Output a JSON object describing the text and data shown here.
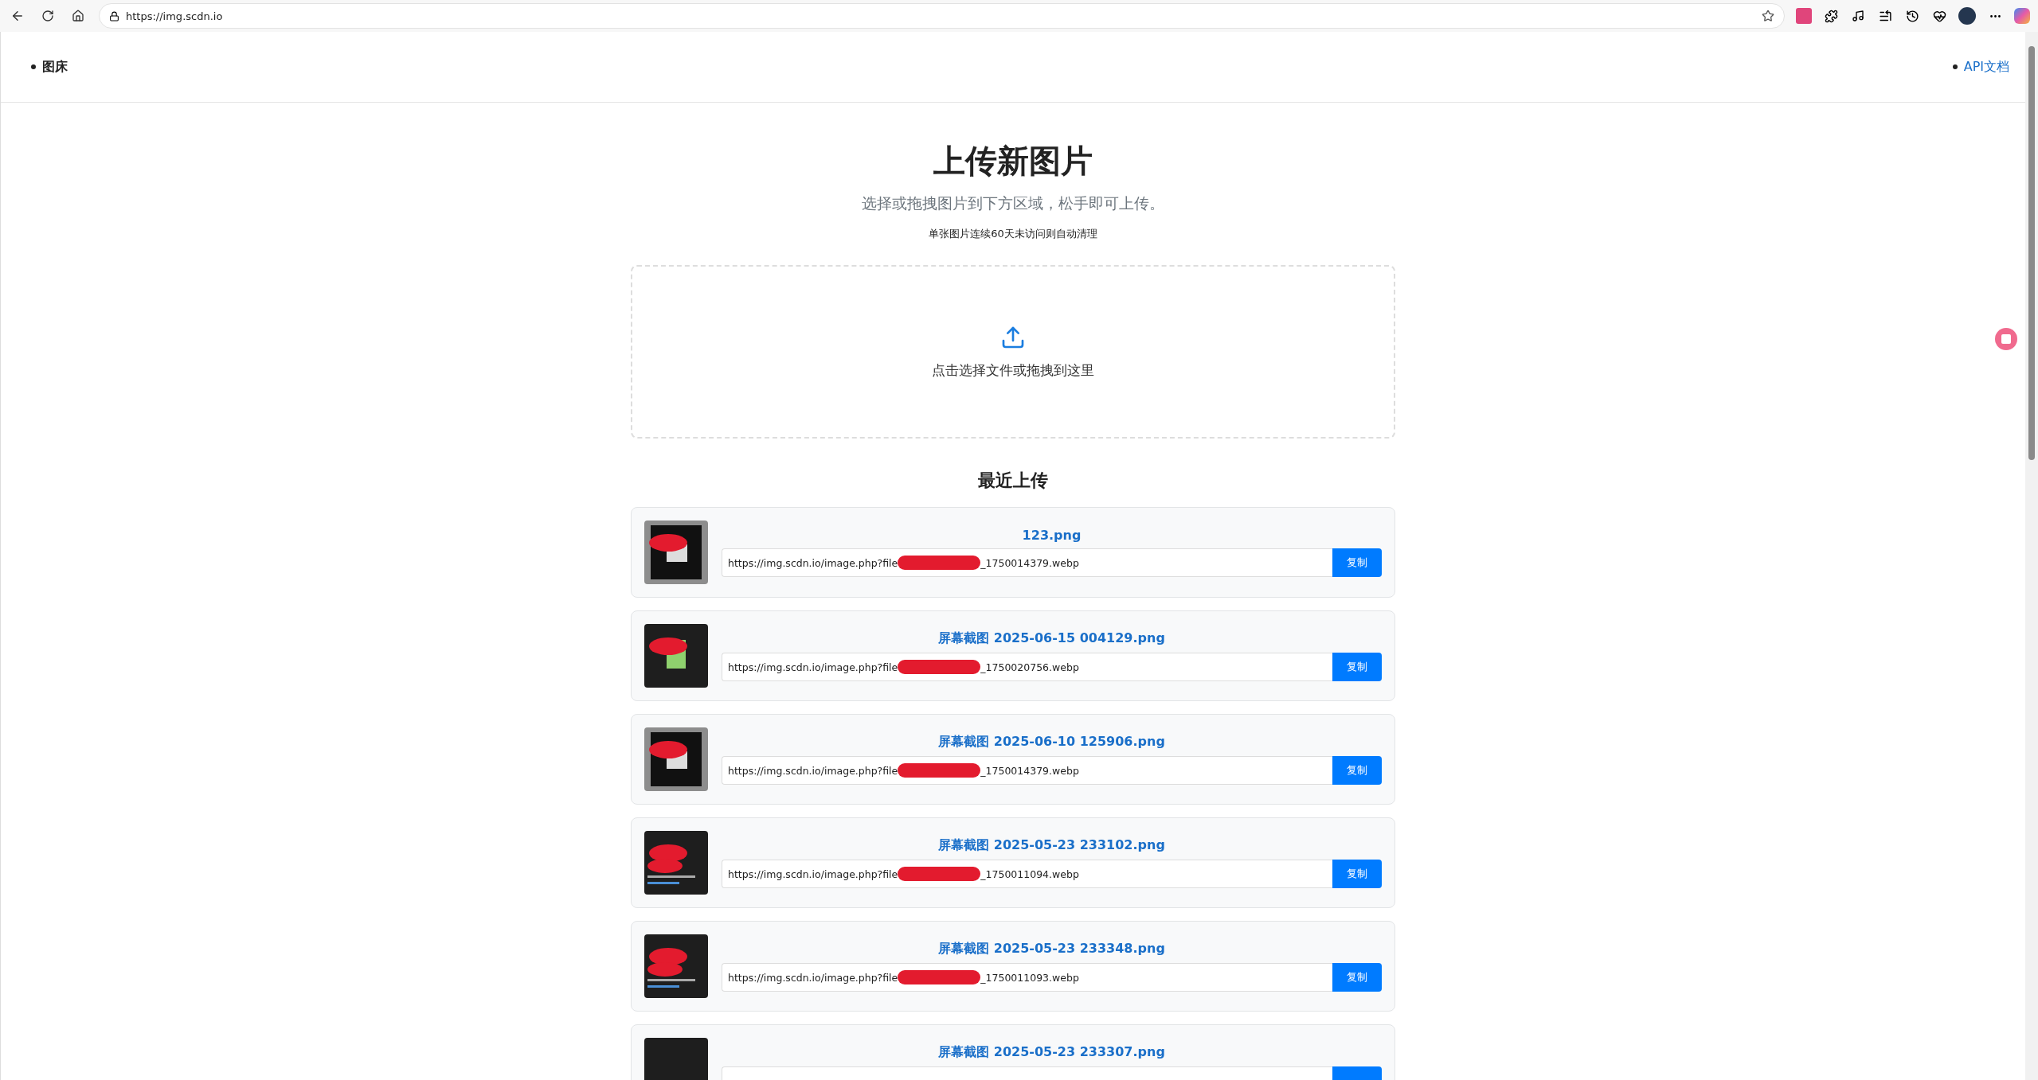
{
  "browser": {
    "url": "https://img.scdn.io"
  },
  "nav": {
    "left": "图床",
    "right": "API文档"
  },
  "upload": {
    "title": "上传新图片",
    "subtitle": "选择或拖拽图片到下方区域，松手即可上传。",
    "note": "单张图片连续60天未访问则自动清理",
    "dropzone_label": "点击选择文件或拖拽到这里"
  },
  "recent": {
    "title": "最近上传",
    "items": [
      {
        "name": "123.png",
        "url_start": "https://img.scdn.io/image.php?file",
        "url_end": "_1750014379.webp",
        "redacted": true,
        "button": "复制"
      },
      {
        "name": "屏幕截图 2025-06-15 004129.png",
        "url_start": "https://img.scdn.io/image.php?file",
        "url_end": "_1750020756.webp",
        "redacted": true,
        "button": "复制"
      },
      {
        "name": "屏幕截图 2025-06-10 125906.png",
        "url_start": "https://img.scdn.io/image.php?file",
        "url_end": "_1750014379.webp",
        "redacted": true,
        "button": "复制"
      },
      {
        "name": "屏幕截图 2025-05-23 233102.png",
        "url_start": "https://img.scdn.io/image.php?file",
        "url_end": "_1750011094.webp",
        "redacted": true,
        "button": "复制"
      },
      {
        "name": "屏幕截图 2025-05-23 233348.png",
        "url_start": "https://img.scdn.io/image.php?file",
        "url_end": "_1750011093.webp",
        "redacted": true,
        "button": "复制"
      },
      {
        "name": "屏幕截图 2025-05-23 233307.png",
        "redacted": false
      }
    ]
  }
}
